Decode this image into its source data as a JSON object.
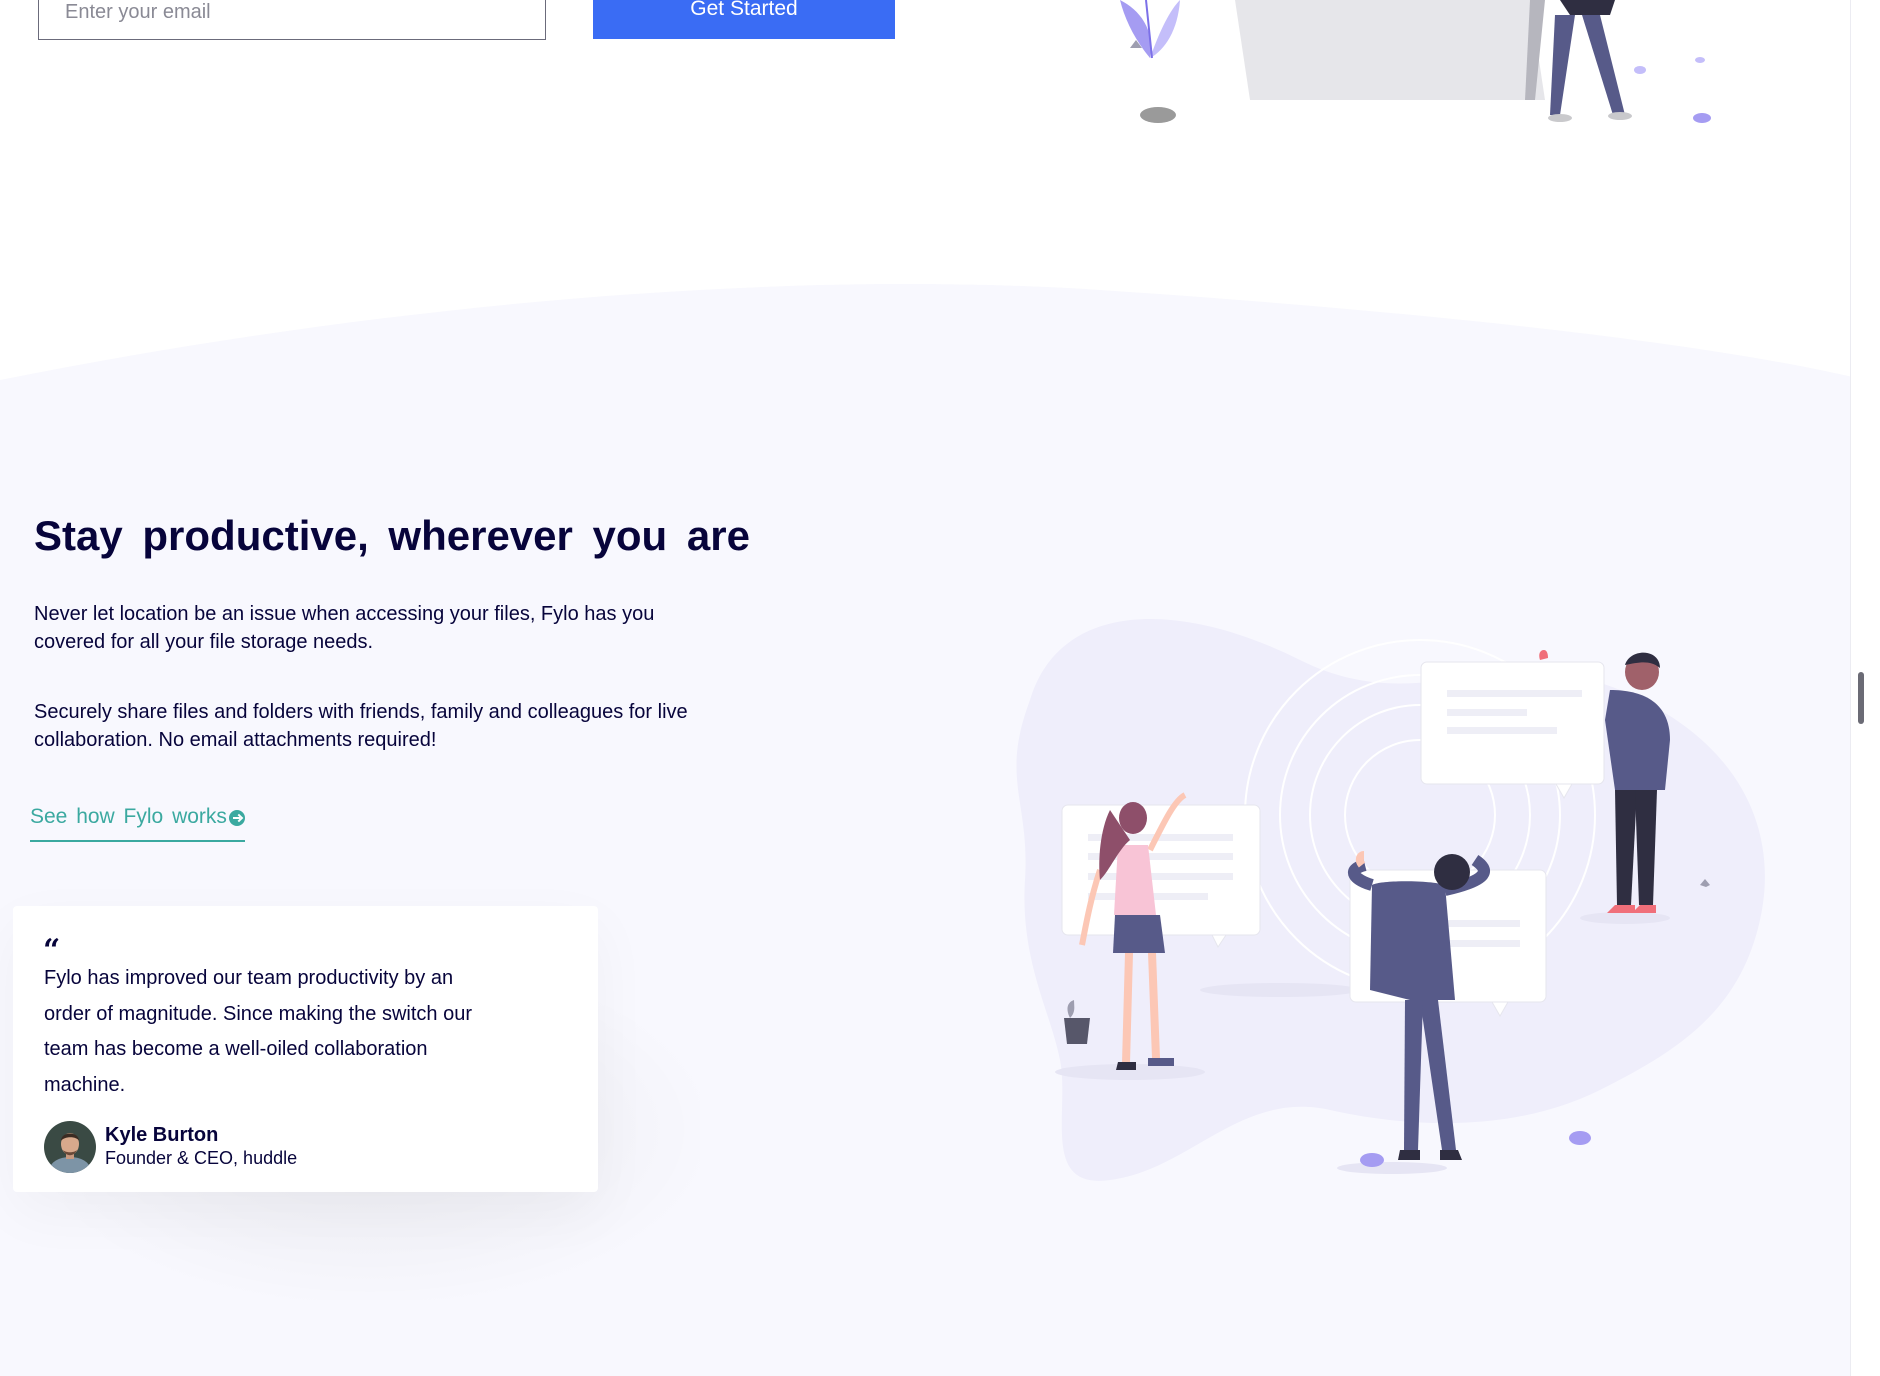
{
  "signup": {
    "email_placeholder": "Enter your email",
    "cta_label": "Get Started"
  },
  "productive": {
    "heading": "Stay productive, wherever you are",
    "paragraph1": "Never let location be an issue when accessing your files, Fylo has you covered for all your file storage needs.",
    "paragraph2": "Securely share files and folders with friends, family and colleagues for live collaboration. No email attachments required!",
    "link_label": "See how Fylo works"
  },
  "testimonial": {
    "quote_mark": "“",
    "quote": "Fylo has improved our team productivity by an order of magnitude. Since making the switch our team has become a well-oiled collaboration machine.",
    "name": "Kyle Burton",
    "role": "Founder & CEO, huddle"
  },
  "colors": {
    "primary": "#3a6cf4",
    "text": "#07043b",
    "accent": "#3ba9a0",
    "section_bg": "#f8f8fe"
  },
  "icons": {
    "arrow": "arrow-right-circle-icon"
  }
}
